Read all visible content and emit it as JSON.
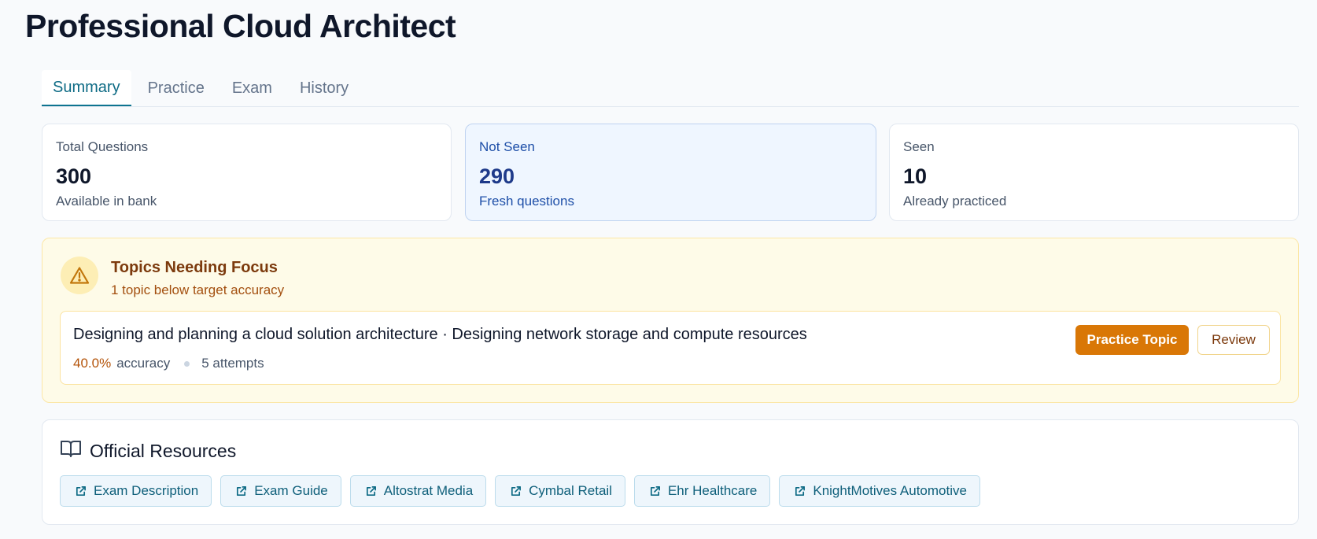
{
  "page": {
    "title": "Professional Cloud Architect"
  },
  "tabs": [
    {
      "label": "Summary",
      "active": true
    },
    {
      "label": "Practice",
      "active": false
    },
    {
      "label": "Exam",
      "active": false
    },
    {
      "label": "History",
      "active": false
    }
  ],
  "stats": {
    "total": {
      "label": "Total Questions",
      "value": "300",
      "sub": "Available in bank"
    },
    "not_seen": {
      "label": "Not Seen",
      "value": "290",
      "sub": "Fresh questions"
    },
    "seen": {
      "label": "Seen",
      "value": "10",
      "sub": "Already practiced"
    }
  },
  "focus": {
    "icon": "warning-icon",
    "title": "Topics Needing Focus",
    "subtitle": "1 topic below target accuracy",
    "topic": {
      "name": "Designing and planning a cloud solution architecture · Designing network storage and compute resources",
      "accuracy": "40.0%",
      "accuracy_label": "accuracy",
      "attempts": "5 attempts",
      "practice_label": "Practice Topic",
      "review_label": "Review"
    }
  },
  "resources": {
    "icon": "book-open-icon",
    "title": "Official Resources",
    "links": [
      {
        "label": "Exam Description",
        "icon": "external-link-icon"
      },
      {
        "label": "Exam Guide",
        "icon": "external-link-icon"
      },
      {
        "label": "Altostrat Media",
        "icon": "external-link-icon"
      },
      {
        "label": "Cymbal Retail",
        "icon": "external-link-icon"
      },
      {
        "label": "Ehr Healthcare",
        "icon": "external-link-icon"
      },
      {
        "label": "KnightMotives Automotive",
        "icon": "external-link-icon"
      }
    ]
  },
  "colors": {
    "accent": "#0e7490",
    "warning": "#d97706",
    "info_card": "#eff6ff",
    "focus_bg": "#fefbe8"
  }
}
